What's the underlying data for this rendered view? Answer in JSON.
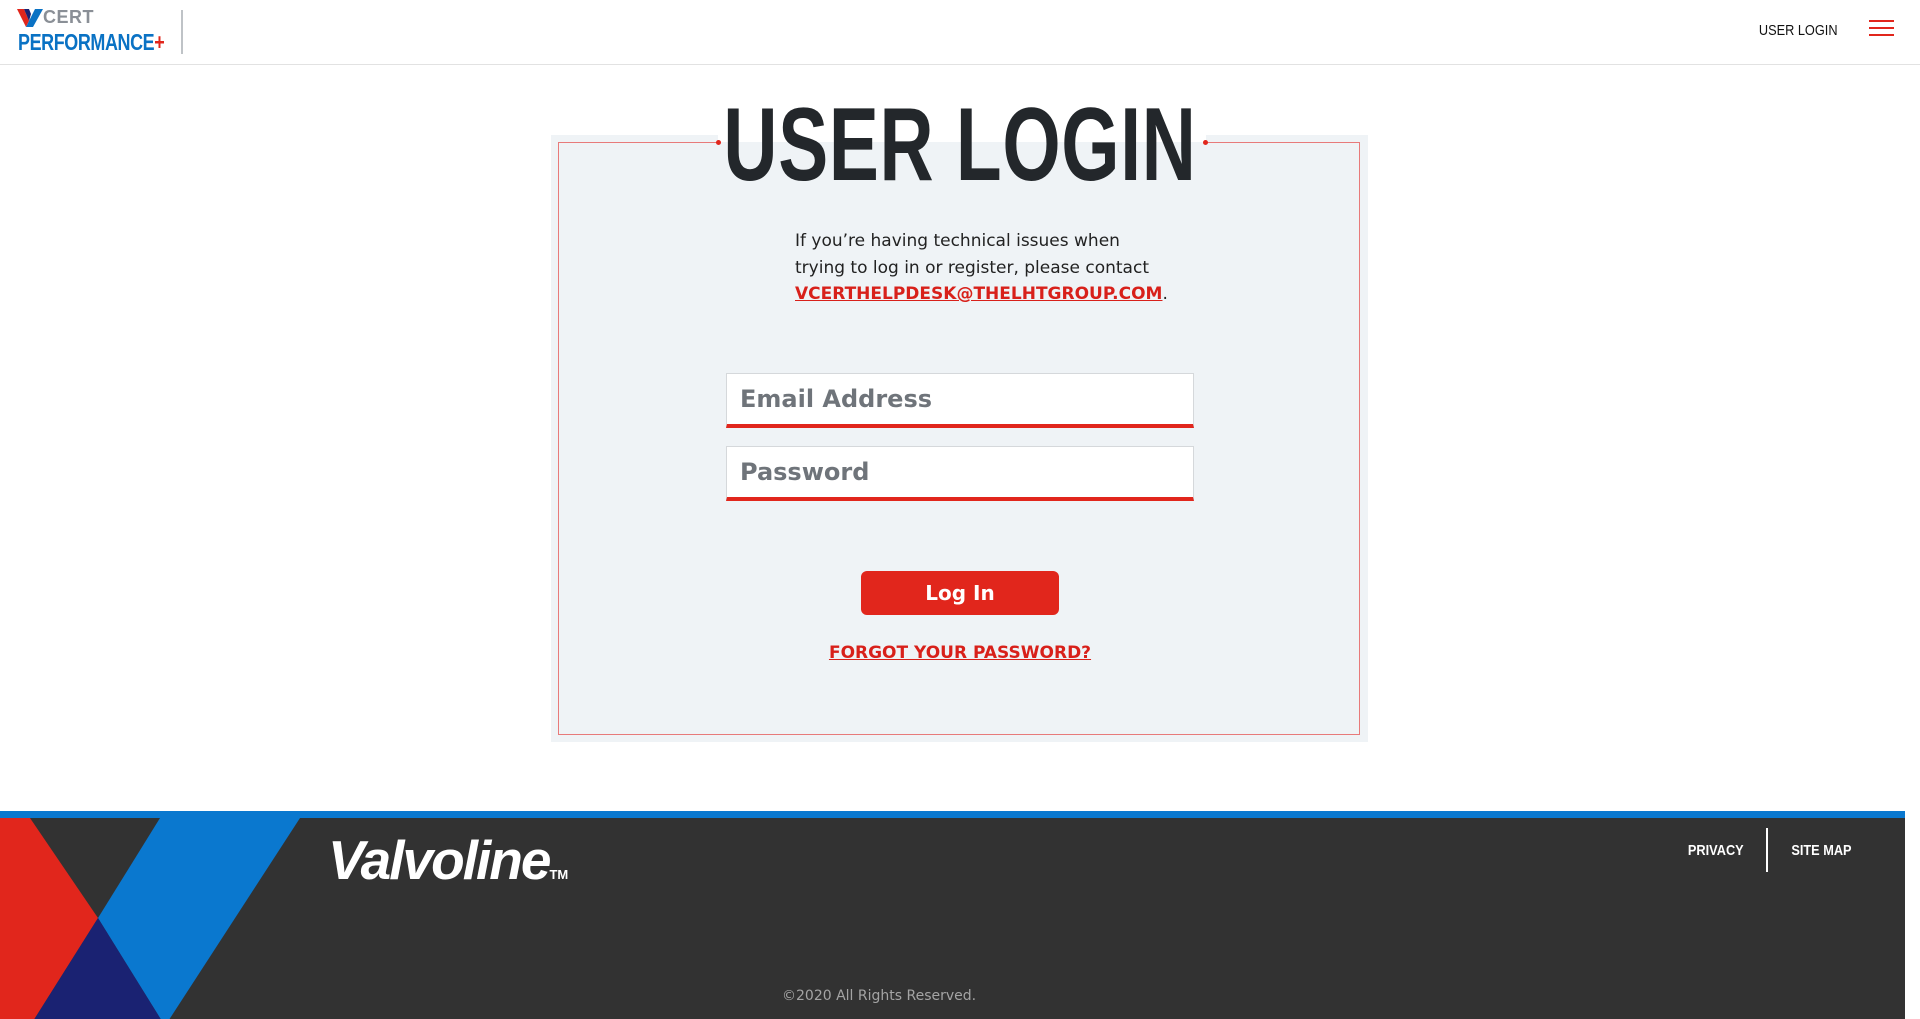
{
  "header": {
    "logo_top": "CERT",
    "logo_bottom": "PERFORMANCE",
    "logo_plus": "+",
    "nav_login": "USER LOGIN",
    "menu_icon": "hamburger-icon"
  },
  "main": {
    "title": "USER LOGIN",
    "help_line1": "If you’re having technical issues when",
    "help_line2": "trying to log in or register, please contact",
    "help_email": "VCERTHELPDESK@THELHTGROUP.COM",
    "help_period": ".",
    "email_placeholder": "Email Address",
    "email_value": "",
    "password_placeholder": "Password",
    "password_value": "",
    "login_label": "Log In",
    "forgot_label": "FORGOT YOUR PASSWORD?"
  },
  "footer": {
    "brand": "Valvoline",
    "brand_tm": "TM",
    "links": [
      "PRIVACY",
      "SITE MAP"
    ],
    "copyright": "©2020 All Rights Reserved."
  },
  "colors": {
    "accent_red": "#e1261c",
    "brand_blue": "#0a78cf",
    "navy": "#1a2272",
    "footer_bg": "#323232",
    "card_bg": "#eff3f6"
  }
}
